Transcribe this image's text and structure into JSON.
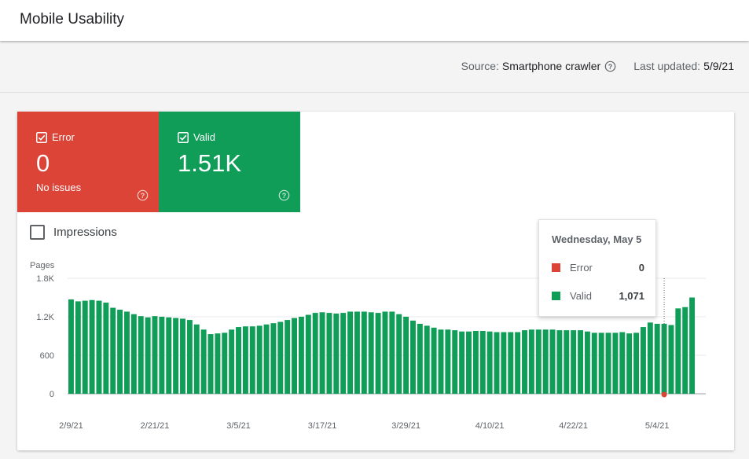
{
  "header": {
    "title": "Mobile Usability"
  },
  "meta": {
    "source_label": "Source:",
    "source_value": "Smartphone crawler",
    "updated_label": "Last updated:",
    "updated_value": "5/9/21"
  },
  "tiles": {
    "error": {
      "label": "Error",
      "value": "0",
      "sub": "No issues",
      "color": "#db4437"
    },
    "valid": {
      "label": "Valid",
      "value": "1.51K",
      "color": "#0f9d58"
    }
  },
  "impressions": {
    "label": "Impressions",
    "checked": false
  },
  "tooltip": {
    "date": "Wednesday, May 5",
    "rows": [
      {
        "name": "Error",
        "value": "0",
        "color": "#db4437"
      },
      {
        "name": "Valid",
        "value": "1,071",
        "color": "#0f9d58"
      }
    ]
  },
  "chart_data": {
    "type": "bar",
    "ylabel": "Pages",
    "ylim": [
      0,
      1800
    ],
    "yticks": [
      {
        "value": 0,
        "label": "0"
      },
      {
        "value": 600,
        "label": "600"
      },
      {
        "value": 1200,
        "label": "1.2K"
      },
      {
        "value": 1800,
        "label": "1.8K"
      }
    ],
    "x_start": "2/9/21",
    "x_tick_labels": [
      {
        "date": "2/9/21",
        "index": 0
      },
      {
        "date": "2/21/21",
        "index": 12
      },
      {
        "date": "3/5/21",
        "index": 24
      },
      {
        "date": "3/17/21",
        "index": 36
      },
      {
        "date": "3/29/21",
        "index": 48
      },
      {
        "date": "4/10/21",
        "index": 60
      },
      {
        "date": "4/22/21",
        "index": 72
      },
      {
        "date": "5/4/21",
        "index": 84
      }
    ],
    "highlight_index": 85,
    "series": [
      {
        "name": "Valid",
        "color": "#0f9d58",
        "values": [
          1470,
          1440,
          1450,
          1460,
          1450,
          1420,
          1340,
          1310,
          1280,
          1240,
          1210,
          1190,
          1210,
          1200,
          1190,
          1180,
          1170,
          1150,
          1080,
          1000,
          930,
          940,
          950,
          1000,
          1040,
          1050,
          1050,
          1060,
          1080,
          1100,
          1120,
          1150,
          1180,
          1200,
          1230,
          1260,
          1270,
          1260,
          1250,
          1260,
          1280,
          1280,
          1280,
          1270,
          1260,
          1280,
          1280,
          1240,
          1200,
          1140,
          1090,
          1060,
          1030,
          1000,
          1000,
          990,
          970,
          970,
          980,
          980,
          970,
          960,
          960,
          960,
          960,
          990,
          1000,
          1000,
          1000,
          1000,
          990,
          990,
          990,
          990,
          970,
          950,
          950,
          950,
          950,
          960,
          940,
          950,
          1040,
          1110,
          1090,
          1090,
          1071,
          1330,
          1350,
          1500
        ]
      },
      {
        "name": "Error",
        "color": "#db4437",
        "values": [
          0,
          0,
          0,
          0,
          0,
          0,
          0,
          0,
          0,
          0,
          0,
          0,
          0,
          0,
          0,
          0,
          0,
          0,
          0,
          0,
          0,
          0,
          0,
          0,
          0,
          0,
          0,
          0,
          0,
          0,
          0,
          0,
          0,
          0,
          0,
          0,
          0,
          0,
          0,
          0,
          0,
          0,
          0,
          0,
          0,
          0,
          0,
          0,
          0,
          0,
          0,
          0,
          0,
          0,
          0,
          0,
          0,
          0,
          0,
          0,
          0,
          0,
          0,
          0,
          0,
          0,
          0,
          0,
          0,
          0,
          0,
          0,
          0,
          0,
          0,
          0,
          0,
          0,
          0,
          0,
          0,
          0,
          0,
          0,
          0,
          0,
          0,
          0,
          0,
          0
        ]
      }
    ]
  }
}
